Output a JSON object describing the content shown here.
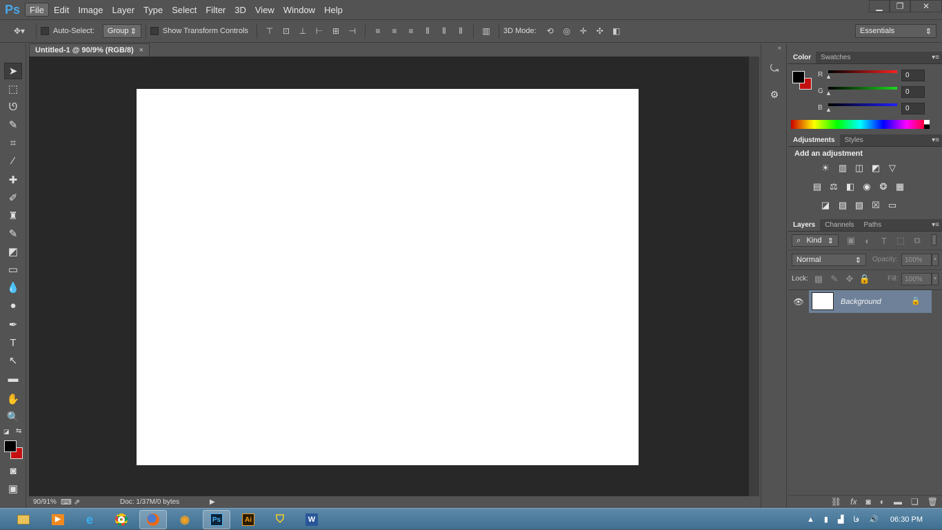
{
  "app": {
    "logo_text": "Ps"
  },
  "menu": [
    "File",
    "Edit",
    "Image",
    "Layer",
    "Type",
    "Select",
    "Filter",
    "3D",
    "View",
    "Window",
    "Help"
  ],
  "window_controls": {
    "minimize": "▁",
    "restore": "❐",
    "close": "✕"
  },
  "options_bar": {
    "auto_select_label": "Auto-Select:",
    "group_value": "Group",
    "show_transform_label": "Show Transform Controls",
    "mode_label": "3D Mode:",
    "workspace_value": "Essentials"
  },
  "document": {
    "tab_title": "Untitled-1 @ 90/9% (RGB/8)",
    "tab_close": "×"
  },
  "status": {
    "zoom": "90/91%",
    "doc_info": "Doc: 1/37M/0 bytes"
  },
  "color_panel": {
    "tabs": [
      "Color",
      "Swatches"
    ],
    "channels": [
      {
        "label": "R",
        "value": "0",
        "color": "#d91c1c"
      },
      {
        "label": "G",
        "value": "0",
        "color": "#19c319"
      },
      {
        "label": "B",
        "value": "0",
        "color": "#1a1ad8"
      }
    ],
    "foreground": "#000000",
    "background": "#c41010"
  },
  "adjustments_panel": {
    "tabs": [
      "Adjustments",
      "Styles"
    ],
    "heading": "Add an adjustment"
  },
  "layers_panel": {
    "tabs": [
      "Layers",
      "Channels",
      "Paths"
    ],
    "filter_kind": "Kind",
    "blend_mode": "Normal",
    "opacity_label": "Opacity:",
    "opacity_value": "100%",
    "lock_label": "Lock:",
    "fill_label": "Fill:",
    "fill_value": "100%",
    "layers": [
      {
        "name": "Background",
        "visible": true,
        "locked": true
      }
    ]
  },
  "taskbar": {
    "time": "06:30 PM",
    "lang": "فا"
  }
}
